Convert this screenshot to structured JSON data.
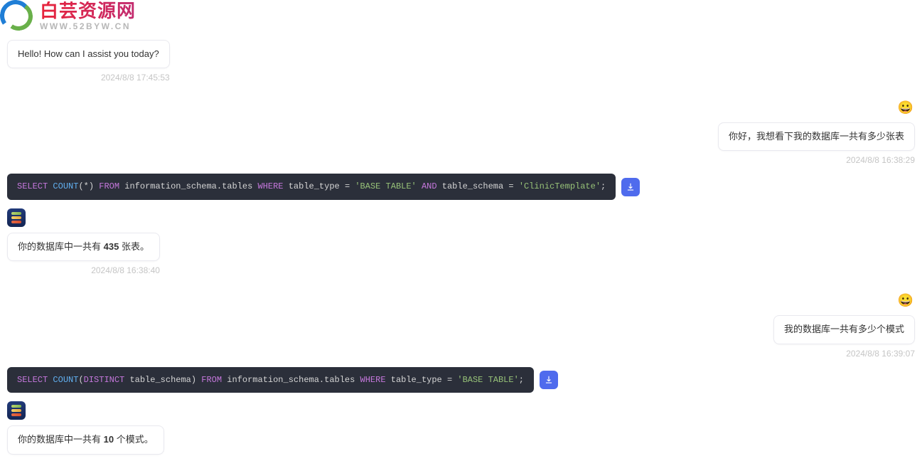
{
  "watermark": {
    "title": "白芸资源网",
    "subtitle": "WWW.52BYW.CN"
  },
  "messages": {
    "greetBubble": "Hello! How can I assist you today?",
    "greetTime": "2024/8/8 17:45:53",
    "userAvatarEmoji1": "😀",
    "userQ1": "你好，我想看下我的数据库一共有多少张表",
    "userQ1Time": "2024/8/8 16:38:29",
    "sql1": {
      "tokens": [
        {
          "t": "SELECT ",
          "c": "kw"
        },
        {
          "t": "COUNT",
          "c": "fn"
        },
        {
          "t": "(*) ",
          "c": "op"
        },
        {
          "t": "FROM ",
          "c": "kw"
        },
        {
          "t": "information_schema.tables ",
          "c": "id"
        },
        {
          "t": "WHERE ",
          "c": "kw"
        },
        {
          "t": "table_type ",
          "c": "id"
        },
        {
          "t": "= ",
          "c": "op"
        },
        {
          "t": "'BASE TABLE' ",
          "c": "str"
        },
        {
          "t": "AND ",
          "c": "kw"
        },
        {
          "t": "table_schema ",
          "c": "id"
        },
        {
          "t": "= ",
          "c": "op"
        },
        {
          "t": "'ClinicTemplate'",
          "c": "str"
        },
        {
          "t": ";",
          "c": "op"
        }
      ]
    },
    "ans1_pre": "你的数据库中一共有 ",
    "ans1_bold": "435",
    "ans1_post": " 张表。",
    "ans1Time": "2024/8/8 16:38:40",
    "userAvatarEmoji2": "😀",
    "userQ2": "我的数据库一共有多少个模式",
    "userQ2Time": "2024/8/8 16:39:07",
    "sql2": {
      "tokens": [
        {
          "t": "SELECT ",
          "c": "kw"
        },
        {
          "t": "COUNT",
          "c": "fn"
        },
        {
          "t": "(",
          "c": "op"
        },
        {
          "t": "DISTINCT ",
          "c": "kw"
        },
        {
          "t": "table_schema) ",
          "c": "id"
        },
        {
          "t": "FROM ",
          "c": "kw"
        },
        {
          "t": "information_schema.tables ",
          "c": "id"
        },
        {
          "t": "WHERE ",
          "c": "kw"
        },
        {
          "t": "table_type ",
          "c": "id"
        },
        {
          "t": "= ",
          "c": "op"
        },
        {
          "t": "'BASE TABLE'",
          "c": "str"
        },
        {
          "t": ";",
          "c": "op"
        }
      ]
    },
    "ans2_pre": "你的数据库中一共有 ",
    "ans2_bold": "10",
    "ans2_post": " 个模式。"
  }
}
